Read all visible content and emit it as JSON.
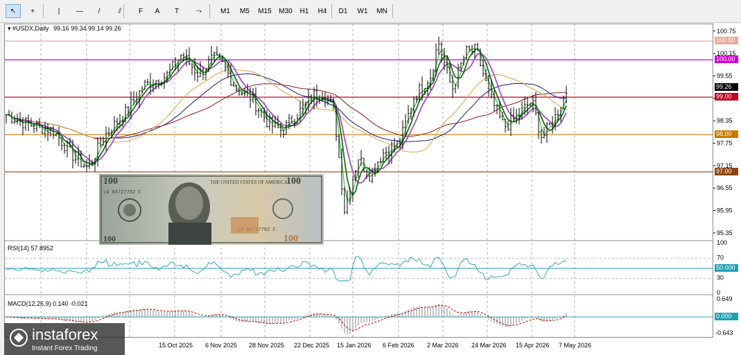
{
  "toolbar": {
    "tools": [
      {
        "name": "cursor-tool",
        "glyph": "↖"
      },
      {
        "name": "crosshair-tool",
        "glyph": "+"
      },
      {
        "name": "vertical-line-tool",
        "glyph": "|"
      },
      {
        "name": "horizontal-line-tool",
        "glyph": "—"
      },
      {
        "name": "trendline-tool",
        "glyph": "/"
      },
      {
        "name": "channel-tool",
        "glyph": "⫽"
      },
      {
        "name": "fibonacci-tool",
        "glyph": "F"
      },
      {
        "name": "text-tool",
        "glyph": "A"
      },
      {
        "name": "label-tool",
        "glyph": "T"
      },
      {
        "name": "shapes-tool",
        "glyph": "⤳"
      }
    ],
    "timeframes": [
      "M1",
      "M5",
      "M15",
      "M30",
      "H1",
      "H4",
      "D1",
      "W1",
      "MN"
    ]
  },
  "chart": {
    "header_symbol": "#USDX,Daily",
    "header_ohlc": "99.16 99.34 99.14 99.26",
    "price_ticks": [
      "100.75",
      "100.15",
      "99.55",
      "98.95",
      "98.35",
      "97.75",
      "97.15",
      "96.55",
      "95.95",
      "95.35"
    ],
    "current_price": "99.26",
    "levels": [
      {
        "value": "100.50",
        "color": "#e8a898"
      },
      {
        "value": "100.00",
        "color": "#d000d0"
      },
      {
        "value": "99.00",
        "color": "#c00020"
      },
      {
        "value": "98.00",
        "color": "#c87a00"
      },
      {
        "value": "97.00",
        "color": "#8b4513"
      }
    ],
    "date_labels": [
      "15 Oct 2025",
      "6 Nov 2025",
      "28 Nov 2025",
      "22 Dec 2025",
      "15 Jan 2026",
      "6 Feb 2026",
      "2 Mar 2026",
      "24 Mar 2026",
      "15 Apr 2026",
      "7 May 2026"
    ]
  },
  "rsi": {
    "label": "RSI(14) 57.8952",
    "ticks": [
      "100",
      "70",
      "50",
      "30",
      "0"
    ],
    "level_tag": "50.000",
    "color": "#20a0b0"
  },
  "macd": {
    "label": "MACD(12,26,9) 0.140 -0.021",
    "ticks": [
      "0.649",
      "-0.643"
    ],
    "zero_tag": "0.000"
  },
  "banknote": {
    "top_text": "THE UNITED STATES OF AMERICA",
    "serial": "LG 04727792 C",
    "denomination": "100"
  },
  "watermark": {
    "brand": "instaforex",
    "tagline": "Instant Forex Trading"
  }
}
